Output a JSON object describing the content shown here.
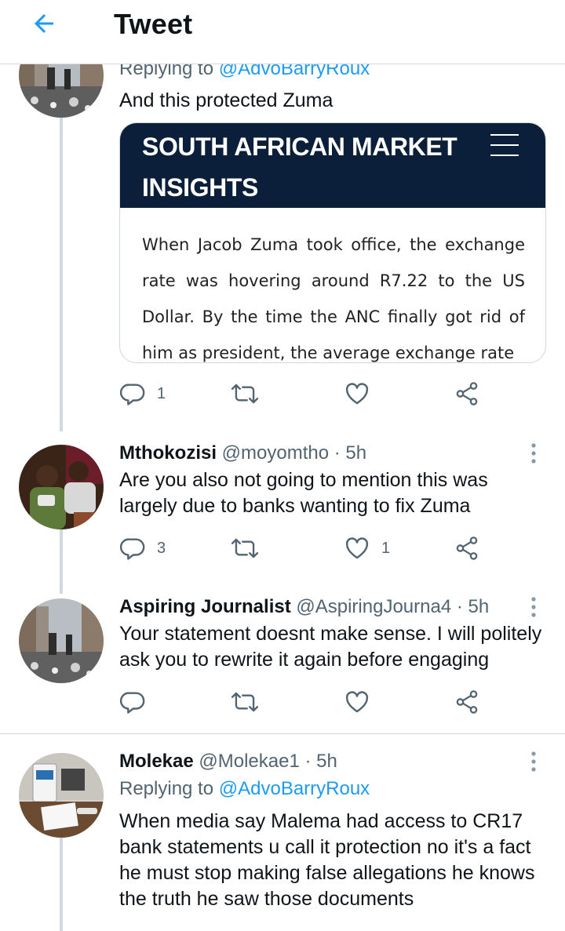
{
  "header": {
    "title": "Tweet",
    "back_icon": "back-arrow-icon",
    "accent": "#1d9bf0"
  },
  "tweets": [
    {
      "replying_prefix": "Replying to",
      "replying_handle": "@AdvoBarryRoux",
      "text": "And this protected Zuma",
      "card": {
        "title": "SOUTH AFRICAN MARKET INSIGHTS",
        "body": "When Jacob Zuma took office, the exchange rate was hovering around R7.22 to the US Dollar. By the time the ANC finally got rid of him as president, the average exchange rate",
        "header_color": "#0b1f3a"
      },
      "replies": "1",
      "retweets": "",
      "likes": ""
    },
    {
      "name": "Mthokozisi",
      "handle": "@moyomtho",
      "time": "5h",
      "text": "Are you also not going to mention this was largely due to banks wanting to fix Zuma",
      "replies": "3",
      "retweets": "",
      "likes": "1"
    },
    {
      "name": "Aspiring Journalist",
      "handle": "@AspiringJourna4",
      "time": "5h",
      "text": "Your statement doesnt make sense. I will politely ask you to rewrite it again before engaging",
      "replies": "",
      "retweets": "",
      "likes": ""
    },
    {
      "name": "Molekae",
      "handle": "@Molekae1",
      "time": "5h",
      "replying_prefix": "Replying to",
      "replying_handle": "@AdvoBarryRoux",
      "text": "When media say Malema had access to CR17 bank statements u call it protection  no it's a fact he must stop making false allegations he knows the truth he saw those documents"
    }
  ],
  "separator": "·"
}
